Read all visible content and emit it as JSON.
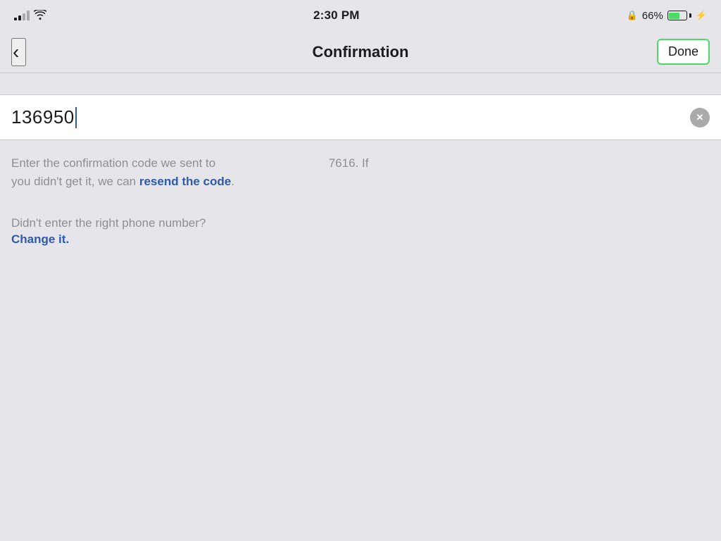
{
  "statusBar": {
    "time": "2:30 PM",
    "batteryPercent": "66%",
    "signalBars": 2,
    "wifiIcon": "wifi",
    "lockIcon": "🔒",
    "boltIcon": "⚡"
  },
  "navBar": {
    "title": "Confirmation",
    "backLabel": "‹",
    "doneLabel": "Done"
  },
  "input": {
    "value": "136950",
    "clearLabel": "✕"
  },
  "info": {
    "mainText": "Enter the confirmation code we sent to",
    "phoneFragment": "7616. If",
    "middleText": "you didn't get it, we can ",
    "resendLabel": "resend the code",
    "periodAfter": ".",
    "changeQuestion": "Didn't enter the right phone number?",
    "changeLink": "Change it."
  }
}
